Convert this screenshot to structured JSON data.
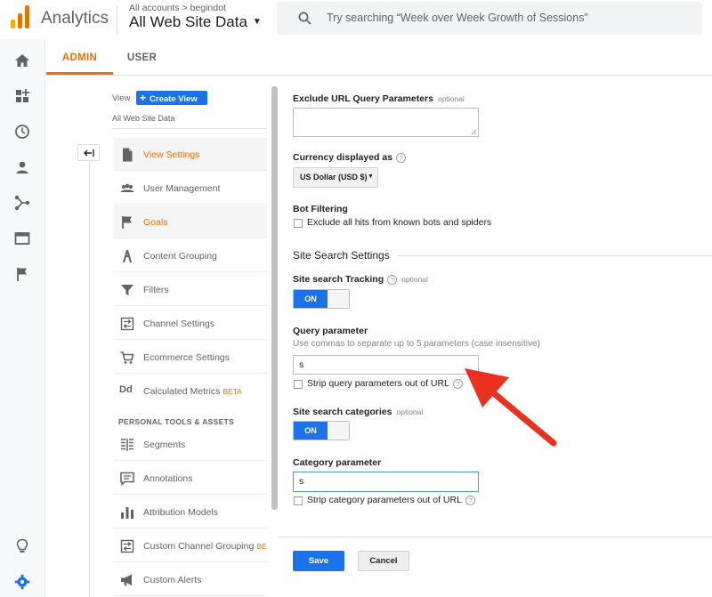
{
  "header": {
    "app_name": "Analytics",
    "breadcrumb": "All accounts > begindot",
    "property": "All Web Site Data",
    "search_placeholder": "Try searching “Week over Week Growth of Sessions”"
  },
  "tabs": [
    "ADMIN",
    "USER"
  ],
  "view_column": {
    "view_label": "View",
    "create_view_label": "Create View",
    "view_name": "All Web Site Data",
    "menu": [
      {
        "label": "View Settings",
        "icon": "document-icon",
        "active": true
      },
      {
        "label": "User Management",
        "icon": "people-icon",
        "active": false
      },
      {
        "label": "Goals",
        "icon": "flag-icon",
        "active": true
      },
      {
        "label": "Content Grouping",
        "icon": "walker-icon",
        "active": false
      },
      {
        "label": "Filters",
        "icon": "funnel-icon",
        "active": false
      },
      {
        "label": "Channel Settings",
        "icon": "channel-icon",
        "active": false
      },
      {
        "label": "Ecommerce Settings",
        "icon": "cart-icon",
        "active": false
      },
      {
        "label": "Calculated Metrics",
        "icon": "dd-icon",
        "active": false,
        "badge": "BETA"
      },
      {
        "label": "Segments",
        "icon": "segments-icon",
        "active": false
      },
      {
        "label": "Annotations",
        "icon": "comment-icon",
        "active": false
      },
      {
        "label": "Attribution Models",
        "icon": "bar-chart-icon",
        "active": false
      },
      {
        "label": "Custom Channel Grouping",
        "icon": "channel-grouping-icon",
        "active": false,
        "badge": "BET"
      },
      {
        "label": "Custom Alerts",
        "icon": "megaphone-icon",
        "active": false
      }
    ],
    "personal_header": "PERSONAL TOOLS & ASSETS"
  },
  "settings": {
    "exclude_url": {
      "label": "Exclude URL Query Parameters",
      "optional": "optional",
      "value": ""
    },
    "currency": {
      "label": "Currency displayed as",
      "value": "US Dollar (USD $)"
    },
    "bot_filtering": {
      "label": "Bot Filtering",
      "checkbox": "Exclude all hits from known bots and spiders"
    },
    "site_search_title": "Site Search Settings",
    "tracking": {
      "label": "Site search Tracking",
      "optional": "optional",
      "toggle": "ON"
    },
    "query_param": {
      "label": "Query parameter",
      "note": "Use commas to separate up to 5 parameters (case insensitive)",
      "value": "s",
      "checkbox": "Strip query parameters out of URL"
    },
    "categories": {
      "label": "Site search categories",
      "optional": "optional",
      "toggle": "ON"
    },
    "category_param": {
      "label": "Category parameter",
      "value": "s",
      "checkbox": "Strip category parameters out of URL"
    },
    "help_glyph": "?"
  },
  "buttons": {
    "save": "Save",
    "cancel": "Cancel"
  },
  "colors": {
    "accent": "#1a73e8",
    "active_orange": "#e8710a",
    "arrow_red": "#e8321f"
  }
}
